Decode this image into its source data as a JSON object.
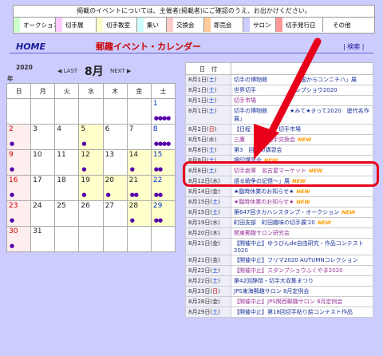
{
  "legend": {
    "header": "掲載のイベントについては、主催者(掲載者)にご確認のうえ、お出かけください。",
    "items": [
      {
        "label": "オークション",
        "color": "#ccffcc"
      },
      {
        "label": "切手展",
        "color": "#ffccff"
      },
      {
        "label": "切手教室",
        "color": "#ffffcc"
      },
      {
        "label": "集い",
        "color": "#ccffff"
      },
      {
        "label": "交換会",
        "color": "#ffcccc"
      },
      {
        "label": "即売会",
        "color": "#ffcc99"
      },
      {
        "label": "サロン",
        "color": "#ccccff"
      },
      {
        "label": "切手発行日",
        "color": "#ff9999"
      },
      {
        "label": "その他",
        "color": "#ffffff"
      }
    ]
  },
  "header": {
    "home": "HOME",
    "title": "郵趣イベント・カレンダー",
    "search": "| 検索 |"
  },
  "calendar": {
    "year": "2020",
    "year_suffix": "年",
    "prev": "◀ LAST",
    "month": "8月",
    "next": "NEXT ▶",
    "weekdays": [
      "日",
      "月",
      "火",
      "水",
      "木",
      "金",
      "土"
    ]
  },
  "events": {
    "col_date": "日　付",
    "col_name": "名",
    "rows": [
      {
        "date": "8月1日(",
        "dow": "土",
        "title": "切手の博物館　　　　　　国からコンニチハ」展",
        "new": ""
      },
      {
        "date": "8月1日(",
        "dow": "土",
        "title": "世界切手　　　　　　　ンプショウ2020",
        "new": ""
      },
      {
        "date": "8月1日(",
        "dow": "土",
        "title": "切手市場",
        "new": ""
      },
      {
        "date": "8月1日(",
        "dow": "土",
        "title": "切手の博物館　　　　★みて★きって2020　歴代名作展」",
        "new": ""
      },
      {
        "date": "8月2日(",
        "dow": "日",
        "title": "【日程　　　　】切手市場",
        "new": ""
      },
      {
        "date": "8月5日(",
        "dow": "水",
        "title": "三鷹　　　　切手交換会",
        "new": "NEW"
      },
      {
        "date": "8月8日(",
        "dow": "土",
        "title": "第3　回押印講習会",
        "new": ""
      },
      {
        "date": "8月8日(",
        "dow": "土",
        "title": "押印講習会",
        "new": "NEW"
      },
      {
        "date": "8月8日(",
        "dow": "土",
        "title": "切手倉庫　名古屋マーケット",
        "new": "NEW"
      },
      {
        "date": "8月12日(",
        "dow": "水",
        "title": "語る戦争の記憶〜」展",
        "new": "NEW"
      },
      {
        "date": "8月14日(",
        "dow": "金",
        "title": "★臨時休業のお知らせ★",
        "new": "NEW"
      },
      {
        "date": "8月15日(",
        "dow": "土",
        "title": "★臨時休業のお知らせ★",
        "new": "NEW"
      },
      {
        "date": "8月15日(",
        "dow": "土",
        "title": "第647回タカハシスタンプ・オークション",
        "new": "NEW"
      },
      {
        "date": "8月19日(",
        "dow": "水",
        "title": "町田支部　町田趣味の切手展'20",
        "new": "NEW"
      },
      {
        "date": "8月20日(",
        "dow": "木",
        "title": "関東郵趣サロン研究会",
        "new": ""
      },
      {
        "date": "8月21日(",
        "dow": "金",
        "title": "【開催中止】ゆうびんde自由研究・作品コンテスト2020",
        "new": ""
      },
      {
        "date": "8月21日(",
        "dow": "金",
        "title": "【開催中止】フリマ2020 AUTUMNコレクション",
        "new": ""
      },
      {
        "date": "8月22日(",
        "dow": "土",
        "title": "【開催中止】スタンプショウふくやま2020",
        "new": ""
      },
      {
        "date": "8月22日(",
        "dow": "土",
        "title": "第42回静岡・切手大収集まつり",
        "new": ""
      },
      {
        "date": "8月23日(",
        "dow": "日",
        "title": "JPS東海郵趣サロン 8月定例会",
        "new": ""
      },
      {
        "date": "8月28日(",
        "dow": "金",
        "title": "【開催中止】JPS関西郵趣サロン 8月定例会",
        "new": ""
      },
      {
        "date": "8月29日(",
        "dow": "土",
        "title": "【開催中止】第18回切手貼り絵コンテスト作品",
        "new": ""
      }
    ]
  },
  "colors": {
    "highlight": "#e8001a",
    "background": "#ccccff"
  }
}
